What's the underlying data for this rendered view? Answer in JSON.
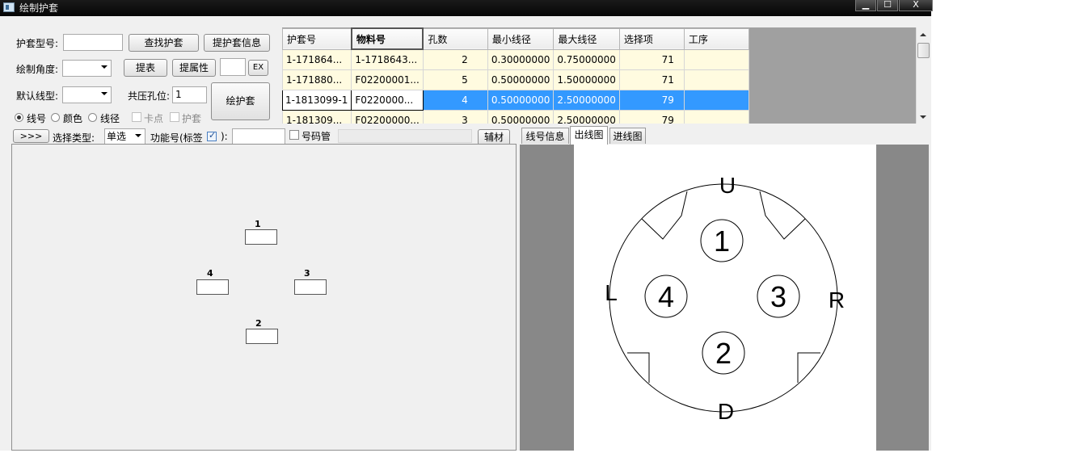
{
  "window": {
    "title": "绘制护套",
    "minimize_label": "▁",
    "maximize_label": "☐",
    "close_label": "X"
  },
  "form": {
    "jacket_model_label": "护套型号:",
    "jacket_model_value": "",
    "find_jacket_button": "查找护套",
    "extract_jacket_info_button": "提护套信息",
    "draw_angle_label": "绘制角度:",
    "draw_angle_value": "",
    "extract_table_button": "提表",
    "extract_attr_button": "提属性",
    "ex_input_value": "",
    "ex_button": "EX",
    "default_wire_label": "默认线型:",
    "default_wire_value": "",
    "crimp_hole_label": "共压孔位:",
    "crimp_hole_value": "1",
    "draw_jacket_button": "绘护套",
    "radio_wire_no": "线号",
    "radio_color": "颜色",
    "radio_wire_dia": "线径",
    "check_card_point": "卡点",
    "check_jacket": "护套"
  },
  "grid": {
    "columns": [
      "护套号",
      "物料号",
      "孔数",
      "最小线径",
      "最大线径",
      "选择项",
      "工序"
    ],
    "rows": [
      [
        "1-171864...",
        "1-1718643...",
        "2",
        "0.30000000",
        "0.75000000",
        "71",
        ""
      ],
      [
        "1-171880...",
        "F02200001...",
        "5",
        "0.50000000",
        "1.50000000",
        "71",
        ""
      ],
      [
        "1-1813099-1",
        "F0220000...",
        "4",
        "0.50000000",
        "2.50000000",
        "79",
        ""
      ],
      [
        "1-181309...",
        "F02200000...",
        "3",
        "0.50000000",
        "2.50000000",
        "79",
        ""
      ]
    ],
    "selected_row": 2
  },
  "toolbar": {
    "expand_button": ">>>",
    "select_type_label": "选择类型:",
    "select_type_value": "单选",
    "function_no_label": "功能号(标签",
    "function_no_suffix": "):",
    "function_no_value": "",
    "code_tube_label": "号码管",
    "aux_material_button": "辅材"
  },
  "pins_view": {
    "pins": [
      {
        "label": "1"
      },
      {
        "label": "4"
      },
      {
        "label": "3"
      },
      {
        "label": "2"
      }
    ]
  },
  "tabs": [
    {
      "label": "线号信息",
      "active": false
    },
    {
      "label": "出线图",
      "active": true
    },
    {
      "label": "进线图",
      "active": false
    }
  ],
  "connector_drawing": {
    "top_label": "U",
    "bottom_label": "D",
    "left_label": "L",
    "right_label": "R",
    "holes": [
      "1",
      "2",
      "3",
      "4"
    ]
  }
}
